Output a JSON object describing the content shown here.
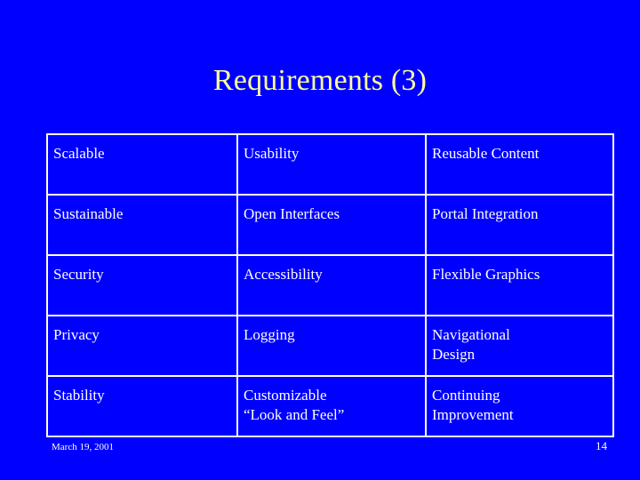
{
  "slide": {
    "title": "Requirements (3)",
    "background_color": "#0000FF",
    "title_color": "#FFFF99",
    "text_color": "#FFFFFF",
    "border_color": "#FFFFFF"
  },
  "table": {
    "rows": [
      {
        "col_a": "Scalable",
        "col_b": "Usability",
        "col_c": "Reusable Content"
      },
      {
        "col_a": "Sustainable",
        "col_b": "Open Interfaces",
        "col_c": "Portal Integration"
      },
      {
        "col_a": "Security",
        "col_b": "Accessibility",
        "col_c": "Flexible Graphics"
      },
      {
        "col_a": "Privacy",
        "col_b": "Logging",
        "col_c_line1": "Navigational",
        "col_c_line2": "Design"
      },
      {
        "col_a": "Stability",
        "col_b_line1": "Customizable",
        "col_b_line2": "“Look and Feel”",
        "col_c_line1": "Continuing",
        "col_c_line2": "Improvement"
      }
    ]
  },
  "footer": {
    "date": "March 19, 2001",
    "page_number": "14"
  }
}
